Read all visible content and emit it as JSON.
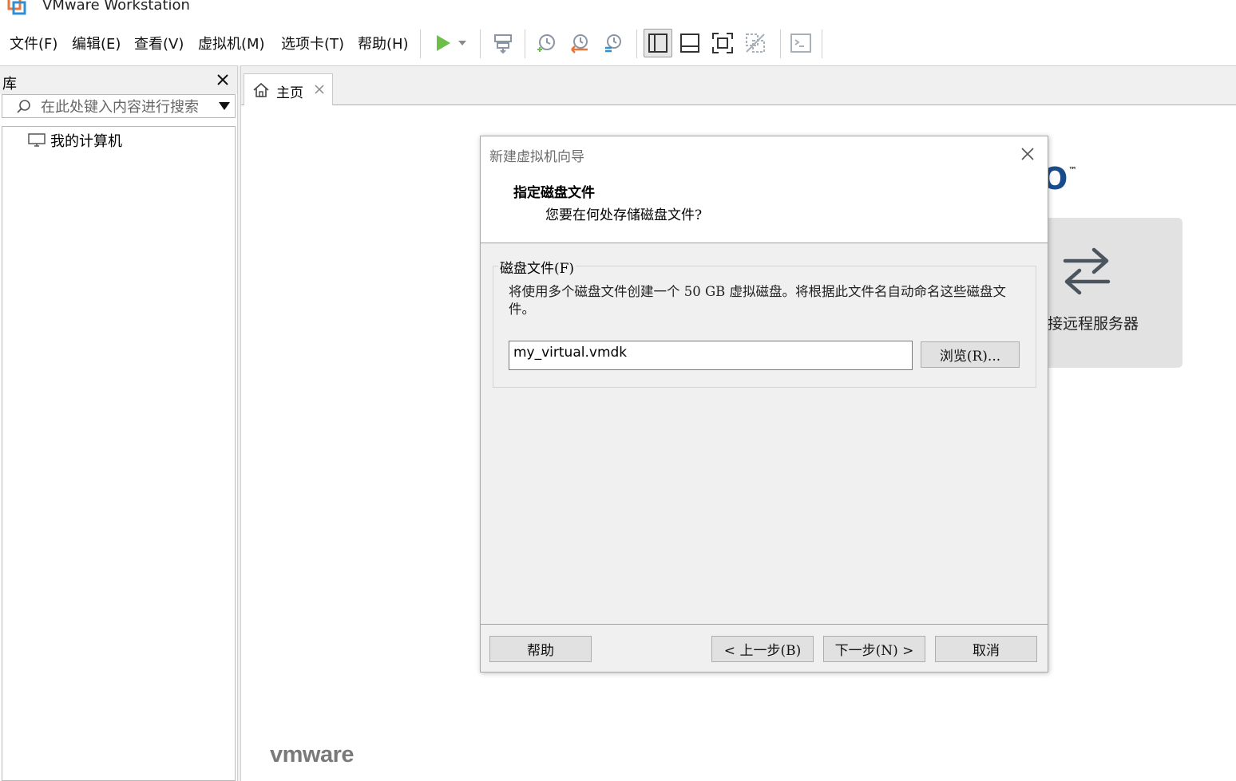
{
  "window": {
    "title": "VMware Workstation"
  },
  "menu": [
    {
      "label": "文件(F)"
    },
    {
      "label": "编辑(E)"
    },
    {
      "label": "查看(V)"
    },
    {
      "label": "虚拟机(M)"
    },
    {
      "label": "选项卡(T)"
    },
    {
      "label": "帮助(H)"
    }
  ],
  "toolbar": {
    "icons": [
      "play-icon",
      "dropdown-icon",
      "send-keys-icon",
      "snapshot-take-icon",
      "snapshot-revert-icon",
      "snapshot-manager-icon",
      "layout-sidebar-icon",
      "layout-thumbnail-icon",
      "fullscreen-icon",
      "unity-icon",
      "console-icon"
    ],
    "colors": {
      "play": "#6cc04a",
      "revert": "#e8763a",
      "manager": "#2f8fd6",
      "icon": "#6d7a87"
    }
  },
  "library": {
    "title": "库",
    "search_placeholder": "在此处键入内容进行搜索",
    "tree": [
      {
        "label": "我的计算机"
      }
    ]
  },
  "tabs": [
    {
      "label": "主页"
    }
  ],
  "home": {
    "connect_card_label": "接远程服务器",
    "brand_fragment": "O",
    "brand_tm": "™",
    "footer_logo": "vmware",
    "colors": {
      "brand": "#1a4c8c",
      "card_bg": "#e2e2e2"
    }
  },
  "dialog": {
    "title": "新建虚拟机向导",
    "heading": "指定磁盘文件",
    "subheading": "您要在何处存储磁盘文件?",
    "group_label": "磁盘文件(F)",
    "description": "将使用多个磁盘文件创建一个 50 GB 虚拟磁盘。将根据此文件名自动命名这些磁盘文件。",
    "disk_file_value": "my_virtual.vmdk",
    "browse_label": "浏览(R)...",
    "help_label": "帮助",
    "back_label": "< 上一步(B)",
    "next_label": "下一步(N) >",
    "cancel_label": "取消"
  }
}
